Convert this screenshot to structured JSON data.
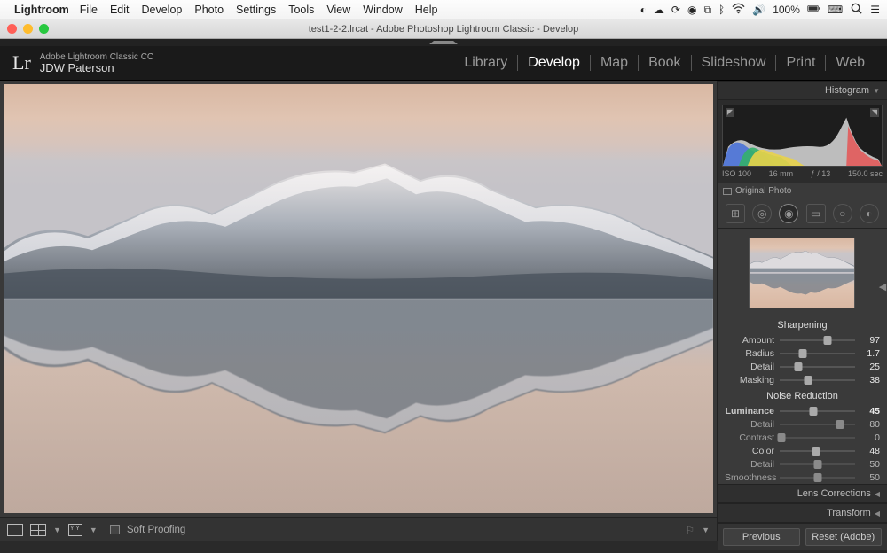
{
  "mac": {
    "app_name": "Lightroom",
    "menus": [
      "File",
      "Edit",
      "Develop",
      "Photo",
      "Settings",
      "Tools",
      "View",
      "Window",
      "Help"
    ],
    "battery": "100%",
    "clock_icons": true
  },
  "window": {
    "title": "test1-2-2.lrcat - Adobe Photoshop Lightroom Classic - Develop"
  },
  "brand": {
    "line1": "Adobe Lightroom Classic CC",
    "line2": "JDW Paterson"
  },
  "modules": {
    "items": [
      "Library",
      "Develop",
      "Map",
      "Book",
      "Slideshow",
      "Print",
      "Web"
    ],
    "active": "Develop"
  },
  "toolbar_bottom": {
    "soft_proof": "Soft Proofing"
  },
  "histogram": {
    "title": "Histogram",
    "iso": "ISO 100",
    "focal": "16 mm",
    "aperture": "ƒ / 13",
    "shutter": "150.0 sec",
    "original_photo": "Original Photo"
  },
  "detail": {
    "sharpening_title": "Sharpening",
    "amount_label": "Amount",
    "amount_val": "97",
    "amount_pct": 64,
    "radius_label": "Radius",
    "radius_val": "1.7",
    "radius_pct": 30,
    "detail_label": "Detail",
    "detail_val": "25",
    "detail_pct": 25,
    "masking_label": "Masking",
    "masking_val": "38",
    "masking_pct": 38,
    "nr_title": "Noise Reduction",
    "lum_label": "Luminance",
    "lum_val": "45",
    "lum_pct": 45,
    "lum_detail_label": "Detail",
    "lum_detail_val": "80",
    "lum_detail_pct": 80,
    "lum_contrast_label": "Contrast",
    "lum_contrast_val": "0",
    "lum_contrast_pct": 2,
    "color_label": "Color",
    "color_val": "48",
    "color_pct": 48,
    "col_detail_label": "Detail",
    "col_detail_val": "50",
    "col_detail_pct": 50,
    "smooth_label": "Smoothness",
    "smooth_val": "50",
    "smooth_pct": 50
  },
  "collapsed_panels": {
    "lens": "Lens Corrections",
    "transform": "Transform"
  },
  "footer": {
    "previous": "Previous",
    "reset": "Reset (Adobe)"
  }
}
